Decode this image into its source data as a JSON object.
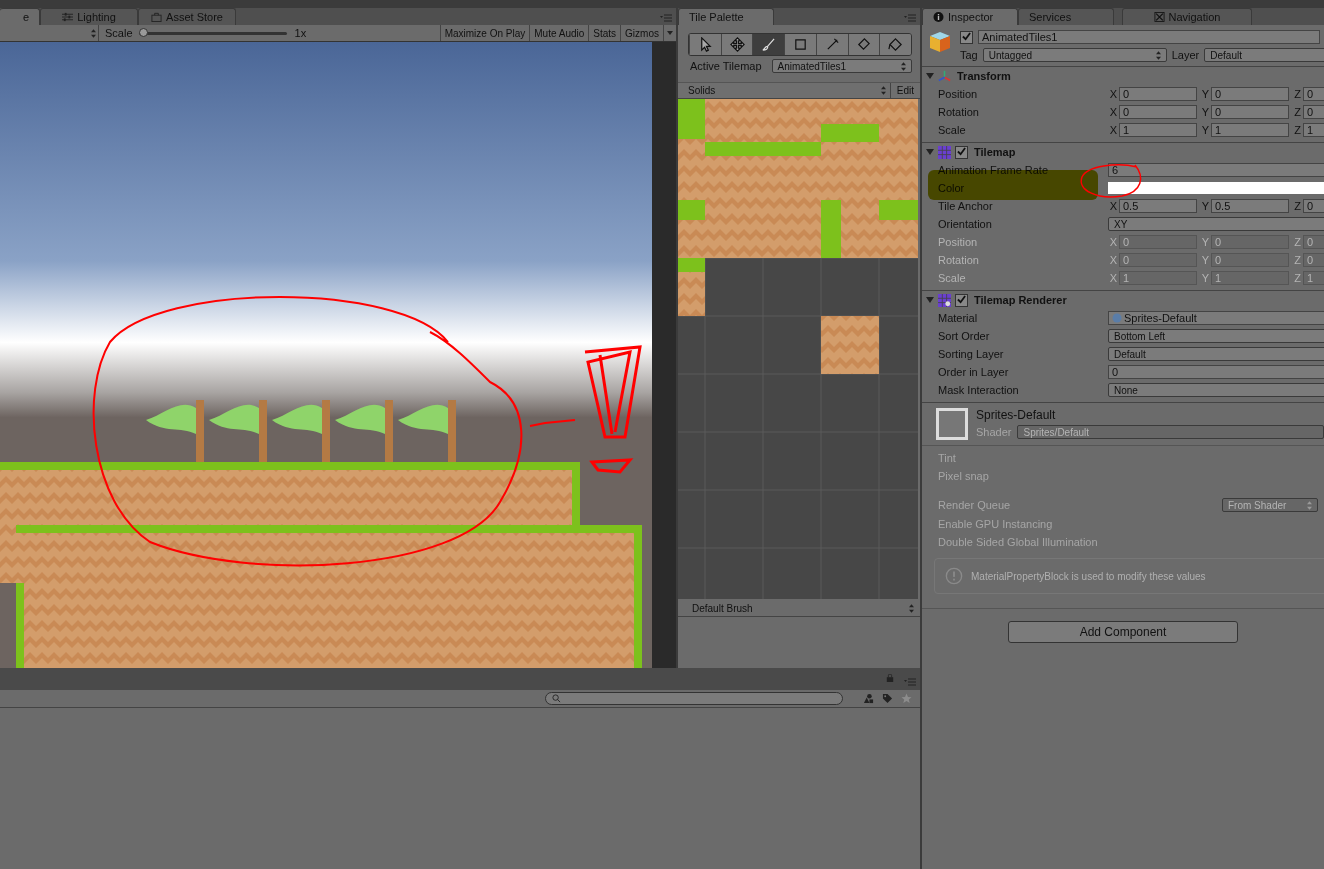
{
  "scene_tabs": [
    {
      "label": "e",
      "selected": true,
      "kind": "game"
    },
    {
      "label": "Lighting",
      "selected": false,
      "kind": "lighting"
    },
    {
      "label": "Asset Store",
      "selected": false,
      "kind": "store"
    }
  ],
  "game_toolbar": {
    "scale_label": "Scale",
    "scale_slider": {
      "level": 0
    },
    "scale_reading": "1x",
    "buttons": [
      "Maximize On Play",
      "Mute Audio",
      "Stats"
    ],
    "gizmos_menu": "Gizmos"
  },
  "tile_palette": {
    "tab": "Tile Palette",
    "tools": [
      {
        "kind": "select",
        "selected": false
      },
      {
        "kind": "move",
        "selected": false
      },
      {
        "kind": "brush",
        "selected": true
      },
      {
        "kind": "box",
        "selected": false
      },
      {
        "kind": "picker",
        "selected": false
      },
      {
        "kind": "eraser",
        "selected": false
      },
      {
        "kind": "fill",
        "selected": false
      }
    ],
    "active_tilemap_label": "Active Tilemap",
    "active_tilemap": "AnimatedTiles1",
    "palette": "Solids",
    "edit_button": "Edit",
    "brush": "Default Brush"
  },
  "inspector": {
    "tabs": [
      {
        "label": "Inspector",
        "selected": true,
        "kind": "info"
      },
      {
        "label": "Services",
        "selected": false,
        "kind": "plain"
      },
      {
        "label": "Navigation",
        "selected": false,
        "kind": "nav"
      }
    ],
    "object": {
      "active": true,
      "name": "AnimatedTiles1",
      "tag_label": "Tag",
      "tag": "Untagged",
      "layer_label": "Layer",
      "layer": "Default"
    },
    "components": [
      {
        "kind": "transform",
        "name": "Transform",
        "expanded": true,
        "rows": [
          {
            "kind": "vector",
            "label": "Position",
            "fields": [
              {
                "axis": "X",
                "value": "0"
              },
              {
                "axis": "Y",
                "value": "0"
              },
              {
                "axis": "Z",
                "value": "0"
              }
            ],
            "disabled": false
          },
          {
            "kind": "vector",
            "label": "Rotation",
            "fields": [
              {
                "axis": "X",
                "value": "0"
              },
              {
                "axis": "Y",
                "value": "0"
              },
              {
                "axis": "Z",
                "value": "0"
              }
            ],
            "disabled": false
          },
          {
            "kind": "vector",
            "label": "Scale",
            "fields": [
              {
                "axis": "X",
                "value": "1"
              },
              {
                "axis": "Y",
                "value": "1"
              },
              {
                "axis": "Z",
                "value": "1"
              }
            ],
            "disabled": false
          }
        ]
      },
      {
        "kind": "tilemap",
        "name": "Tilemap",
        "enabled": true,
        "expanded": true,
        "rows": [
          {
            "kind": "number",
            "label": "Animation Frame Rate",
            "value": "6",
            "disabled": false
          },
          {
            "kind": "color",
            "label": "Color",
            "color": "#ffffff",
            "disabled": false
          },
          {
            "kind": "vector",
            "label": "Tile Anchor",
            "fields": [
              {
                "axis": "X",
                "value": "0.5"
              },
              {
                "axis": "Y",
                "value": "0.5"
              },
              {
                "axis": "Z",
                "value": "0"
              }
            ],
            "disabled": false
          },
          {
            "kind": "dropdown",
            "label": "Orientation",
            "value": "XY",
            "disabled": false
          },
          {
            "kind": "vector",
            "label": "Position",
            "fields": [
              {
                "axis": "X",
                "value": "0"
              },
              {
                "axis": "Y",
                "value": "0"
              },
              {
                "axis": "Z",
                "value": "0"
              }
            ],
            "disabled": true
          },
          {
            "kind": "vector",
            "label": "Rotation",
            "fields": [
              {
                "axis": "X",
                "value": "0"
              },
              {
                "axis": "Y",
                "value": "0"
              },
              {
                "axis": "Z",
                "value": "0"
              }
            ],
            "disabled": true
          },
          {
            "kind": "vector",
            "label": "Scale",
            "fields": [
              {
                "axis": "X",
                "value": "1"
              },
              {
                "axis": "Y",
                "value": "1"
              },
              {
                "axis": "Z",
                "value": "1"
              }
            ],
            "disabled": true
          }
        ]
      },
      {
        "kind": "renderer",
        "name": "Tilemap Renderer",
        "enabled": true,
        "expanded": true,
        "rows": [
          {
            "kind": "object",
            "label": "Material",
            "value": "Sprites-Default",
            "disabled": false
          },
          {
            "kind": "dropdown",
            "label": "Sort Order",
            "value": "Bottom Left",
            "disabled": false
          },
          {
            "kind": "dropdown",
            "label": "Sorting Layer",
            "value": "Default",
            "disabled": false
          },
          {
            "kind": "number",
            "label": "Order in Layer",
            "value": "0",
            "disabled": false
          },
          {
            "kind": "dropdown",
            "label": "Mask Interaction",
            "value": "None",
            "disabled": false
          }
        ]
      }
    ],
    "material": {
      "name": "Sprites-Default",
      "shader_label": "Shader",
      "shader": "Sprites/Default",
      "properties": [
        "Tint",
        "Pixel snap"
      ],
      "render_queue_label": "Render Queue",
      "render_queue": "From Shader",
      "options": [
        "Enable GPU Instancing",
        "Double Sided Global Illumination"
      ],
      "info": "MaterialPropertyBlock is used to modify these values"
    },
    "add_component": "Add Component"
  }
}
